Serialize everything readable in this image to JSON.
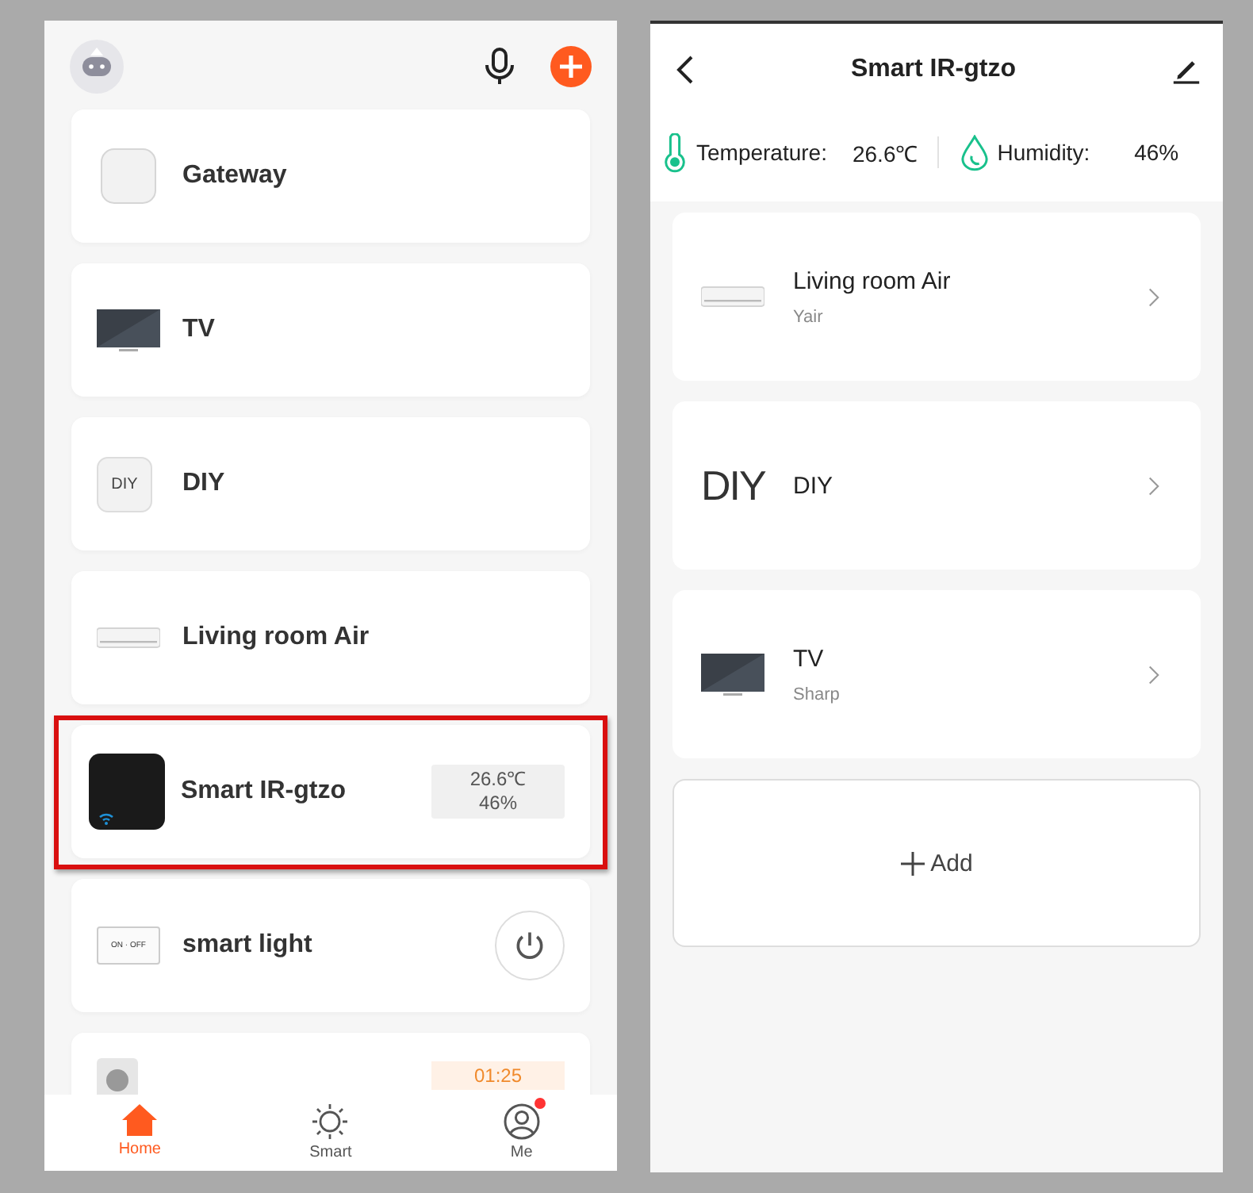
{
  "home": {
    "devices": [
      {
        "kind": "gateway",
        "name": "Gateway",
        "highlighted": false
      },
      {
        "kind": "tv",
        "name": "TV",
        "highlighted": false
      },
      {
        "kind": "diy",
        "name": "DIY",
        "icon_text": "DIY",
        "highlighted": false
      },
      {
        "kind": "air",
        "name": "Living room Air",
        "highlighted": false
      },
      {
        "kind": "ir",
        "name": "Smart IR-gtzo",
        "readings": [
          "26.6℃",
          "46%"
        ],
        "highlighted": true
      },
      {
        "kind": "light",
        "name": "smart light",
        "icon_text": "ON · OFF",
        "power_on": false,
        "highlighted": false
      },
      {
        "kind": "socket",
        "timer": "01:25",
        "highlighted": false
      }
    ],
    "tabs": [
      {
        "kind": "home",
        "label": "Home",
        "selected": true,
        "badge": false
      },
      {
        "kind": "smart",
        "label": "Smart",
        "selected": false,
        "badge": false
      },
      {
        "kind": "me",
        "label": "Me",
        "selected": false,
        "badge": true
      }
    ]
  },
  "detail": {
    "title": "Smart IR-gtzo",
    "sensors": [
      {
        "kind": "temperature",
        "label": "Temperature:",
        "value": "26.6℃"
      },
      {
        "kind": "humidity",
        "label": "Humidity:",
        "value": "46%"
      }
    ],
    "remotes": [
      {
        "kind": "air",
        "name": "Living room Air",
        "brand": "Yair"
      },
      {
        "kind": "diy",
        "name": "DIY",
        "icon_text": "DIY"
      },
      {
        "kind": "tv",
        "name": "TV",
        "brand": "Sharp"
      }
    ],
    "add_label": "Add"
  }
}
